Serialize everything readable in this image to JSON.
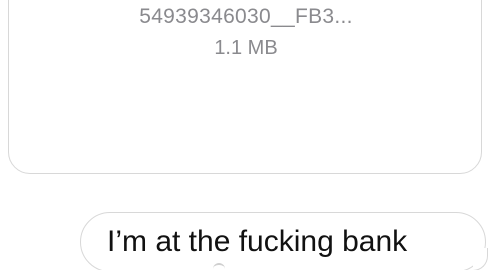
{
  "attachment": {
    "file_name": "54939346030__FB3...",
    "file_size": "1.1 MB"
  },
  "outgoing_message": {
    "text": "I’m at the fucking bank"
  },
  "colors": {
    "bubble_border": "#d8d8d8",
    "meta_text": "#8a8a8e",
    "message_text": "#111111",
    "background": "#ffffff"
  }
}
